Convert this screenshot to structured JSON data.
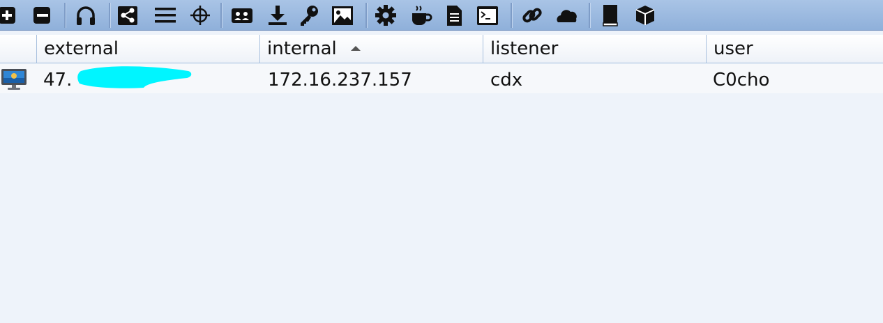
{
  "toolbar": {
    "buttons": [
      {
        "icon": "plus-icon",
        "label": "Add"
      },
      {
        "icon": "minus-icon",
        "label": "Remove"
      },
      {
        "icon": "headphones-icon",
        "label": "Listeners"
      },
      {
        "icon": "share-icon",
        "label": "Pivot graph"
      },
      {
        "icon": "list-icon",
        "label": "Session table"
      },
      {
        "icon": "crosshair-icon",
        "label": "Targets"
      },
      {
        "icon": "id-card-icon",
        "label": "Credentials"
      },
      {
        "icon": "download-icon",
        "label": "Downloads"
      },
      {
        "icon": "key-icon",
        "label": "Keystrokes"
      },
      {
        "icon": "image-icon",
        "label": "Screenshots"
      },
      {
        "icon": "gear-icon",
        "label": "Payload generator"
      },
      {
        "icon": "coffee-icon",
        "label": "Java payload"
      },
      {
        "icon": "document-icon",
        "label": "Document"
      },
      {
        "icon": "terminal-icon",
        "label": "Console"
      },
      {
        "icon": "link-icon",
        "label": "Links"
      },
      {
        "icon": "cloud-icon",
        "label": "Cloud"
      },
      {
        "icon": "book-icon",
        "label": "Manual"
      },
      {
        "icon": "cube-icon",
        "label": "Package"
      }
    ]
  },
  "table": {
    "columns": [
      {
        "key": "external",
        "label": "external",
        "sorted": false
      },
      {
        "key": "internal",
        "label": "internal",
        "sorted": true,
        "direction": "ascending"
      },
      {
        "key": "listener",
        "label": "listener",
        "sorted": false
      },
      {
        "key": "user",
        "label": "user",
        "sorted": false
      }
    ],
    "rows": [
      {
        "icon": "computer-icon",
        "external": "47.",
        "internal": "172.16.237.157",
        "listener": "cdx",
        "user": "C0cho"
      }
    ]
  },
  "colors": {
    "toolbar": "#9bb9e0",
    "background": "#eef3fa",
    "redaction": "#00f5ff"
  }
}
